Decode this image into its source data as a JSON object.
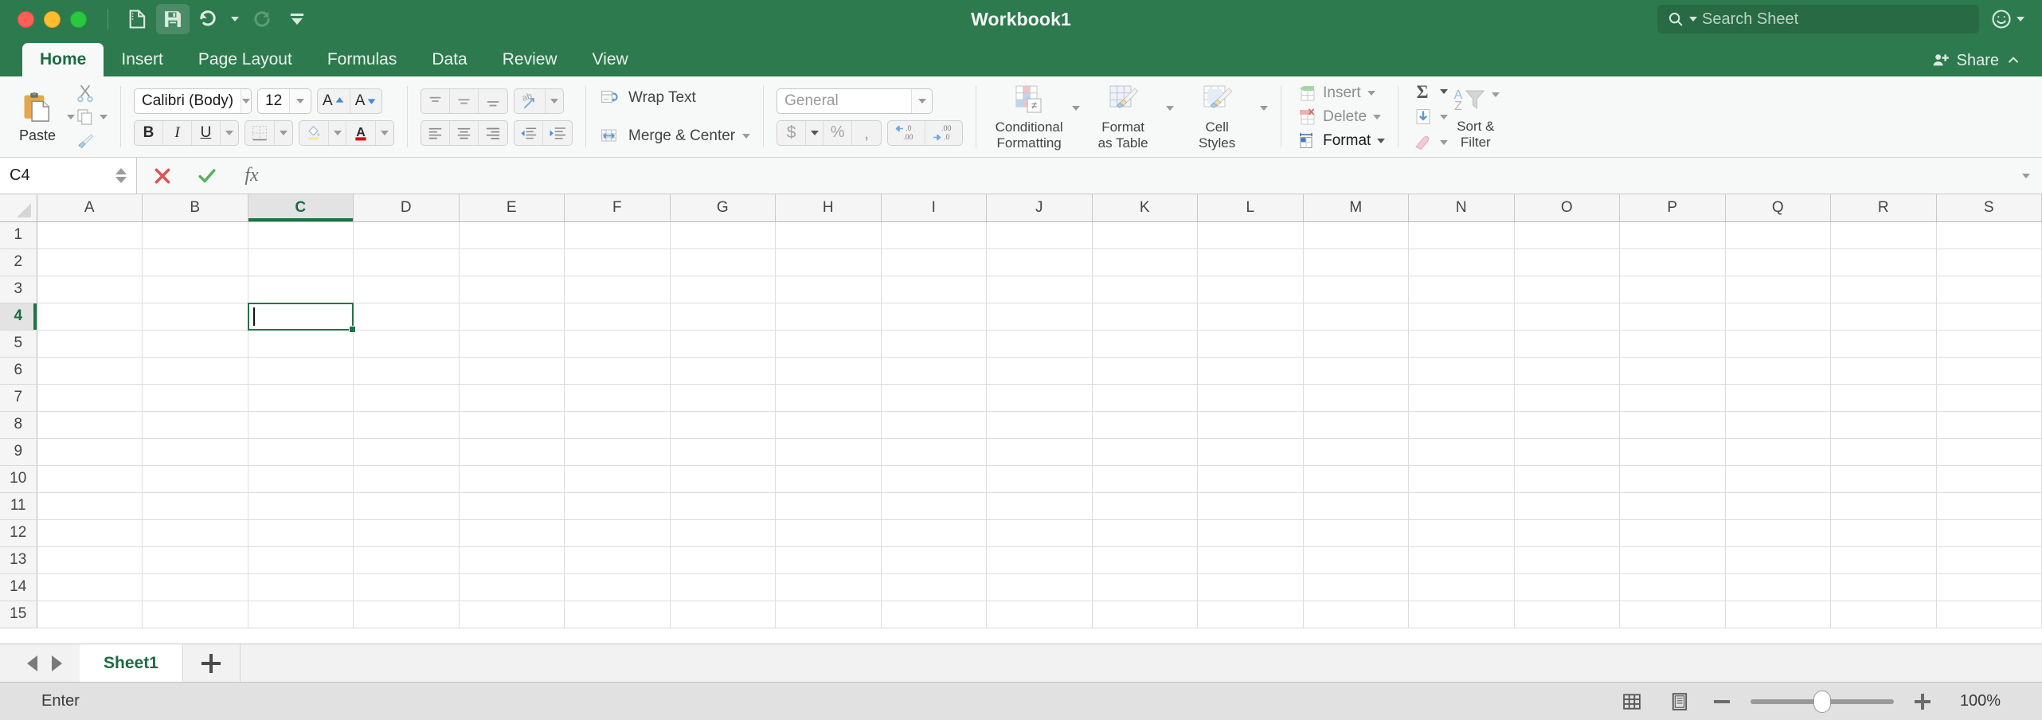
{
  "window": {
    "title": "Workbook1",
    "traffic_lights": [
      "close",
      "minimize",
      "maximize"
    ],
    "accent_green": "#2D7A4F",
    "tab_green": "#217346"
  },
  "quick_access": {
    "items": [
      {
        "name": "sidebar-toggle-icon",
        "label": "Sidebar"
      },
      {
        "name": "save-icon",
        "label": "Save"
      },
      {
        "name": "undo-icon",
        "label": "Undo"
      },
      {
        "name": "redo-icon",
        "label": "Redo"
      },
      {
        "name": "customize-toolbar-icon",
        "label": "Customize Toolbar"
      }
    ]
  },
  "search": {
    "placeholder": "Search Sheet",
    "icon": "search-icon"
  },
  "smiley": {
    "icon": "smiley-icon"
  },
  "ribbon": {
    "tabs": [
      {
        "label": "Home",
        "active": true
      },
      {
        "label": "Insert",
        "active": false
      },
      {
        "label": "Page Layout",
        "active": false
      },
      {
        "label": "Formulas",
        "active": false
      },
      {
        "label": "Data",
        "active": false
      },
      {
        "label": "Review",
        "active": false
      },
      {
        "label": "View",
        "active": false
      }
    ],
    "share": {
      "label": "Share",
      "icon": "person-plus-icon"
    },
    "clipboard": {
      "paste_label": "Paste",
      "cut_label": "Cut",
      "copy_label": "Copy",
      "format_painter_label": "Format Painter"
    },
    "font": {
      "family_value": "Calibri (Body)",
      "size_value": "12",
      "grow_label": "A",
      "shrink_label": "A",
      "bold_label": "B",
      "italic_label": "I",
      "underline_label": "U",
      "borders_label": "Borders",
      "fill_color_label": "A",
      "font_color_label": "A",
      "fill_color": "#F2EE9B",
      "font_color": "#E00000"
    },
    "alignment": {
      "wrap_text_label": "Wrap Text",
      "merge_center_label": "Merge & Center",
      "top_align": "Top Align",
      "middle_align": "Middle Align",
      "bottom_align": "Bottom Align",
      "orientation": "Orientation",
      "align_left": "Align Left",
      "align_center": "Center",
      "align_right": "Align Right",
      "decrease_indent": "Decrease Indent",
      "increase_indent": "Increase Indent"
    },
    "number": {
      "format_value": "General",
      "currency_label": "$",
      "percent_label": "%",
      "comma_label": ",",
      "increase_decimal_label": ".0 / .00",
      "decrease_decimal_label": ".00 / .0"
    },
    "styles": [
      {
        "label_line1": "Conditional",
        "label_line2": "Formatting",
        "icon": "conditional-formatting-icon"
      },
      {
        "label_line1": "Format",
        "label_line2": "as Table",
        "icon": "format-as-table-icon"
      },
      {
        "label_line1": "Cell",
        "label_line2": "Styles",
        "icon": "cell-styles-icon"
      }
    ],
    "cells": [
      {
        "label": "Insert",
        "icon": "insert-cells-icon",
        "enabled": false
      },
      {
        "label": "Delete",
        "icon": "delete-cells-icon",
        "enabled": false
      },
      {
        "label": "Format",
        "icon": "format-cells-icon",
        "enabled": true
      }
    ],
    "editing": {
      "autosum_label": "AutoSum",
      "fill_label": "Fill",
      "clear_label": "Clear",
      "sort_filter_line1": "Sort &",
      "sort_filter_line2": "Filter"
    }
  },
  "formula_bar": {
    "name_box_value": "C4",
    "cancel_label": "Cancel",
    "enter_label": "Enter",
    "function_label": "fx",
    "formula_value": ""
  },
  "grid": {
    "columns": [
      "A",
      "B",
      "C",
      "D",
      "E",
      "F",
      "G",
      "H",
      "I",
      "J",
      "K",
      "L",
      "M",
      "N",
      "O",
      "P",
      "Q",
      "R",
      "S"
    ],
    "rows": [
      "1",
      "2",
      "3",
      "4",
      "5",
      "6",
      "7",
      "8",
      "9",
      "10",
      "11",
      "12",
      "13",
      "14",
      "15"
    ],
    "selected_column": "C",
    "selected_row": "4",
    "active_cell": "C4",
    "active_cell_value": "",
    "editing": true
  },
  "sheet_tabs": {
    "prev_label": "Previous Sheet",
    "next_label": "Next Sheet",
    "tabs": [
      {
        "label": "Sheet1",
        "active": true
      }
    ],
    "add_label": "New Sheet"
  },
  "status_bar": {
    "mode": "Enter",
    "normal_view_label": "Normal View",
    "page_layout_label": "Page Layout View",
    "zoom_out_label": "Zoom Out",
    "zoom_in_label": "Zoom In",
    "zoom_value": "100%",
    "zoom_percent": 100
  }
}
